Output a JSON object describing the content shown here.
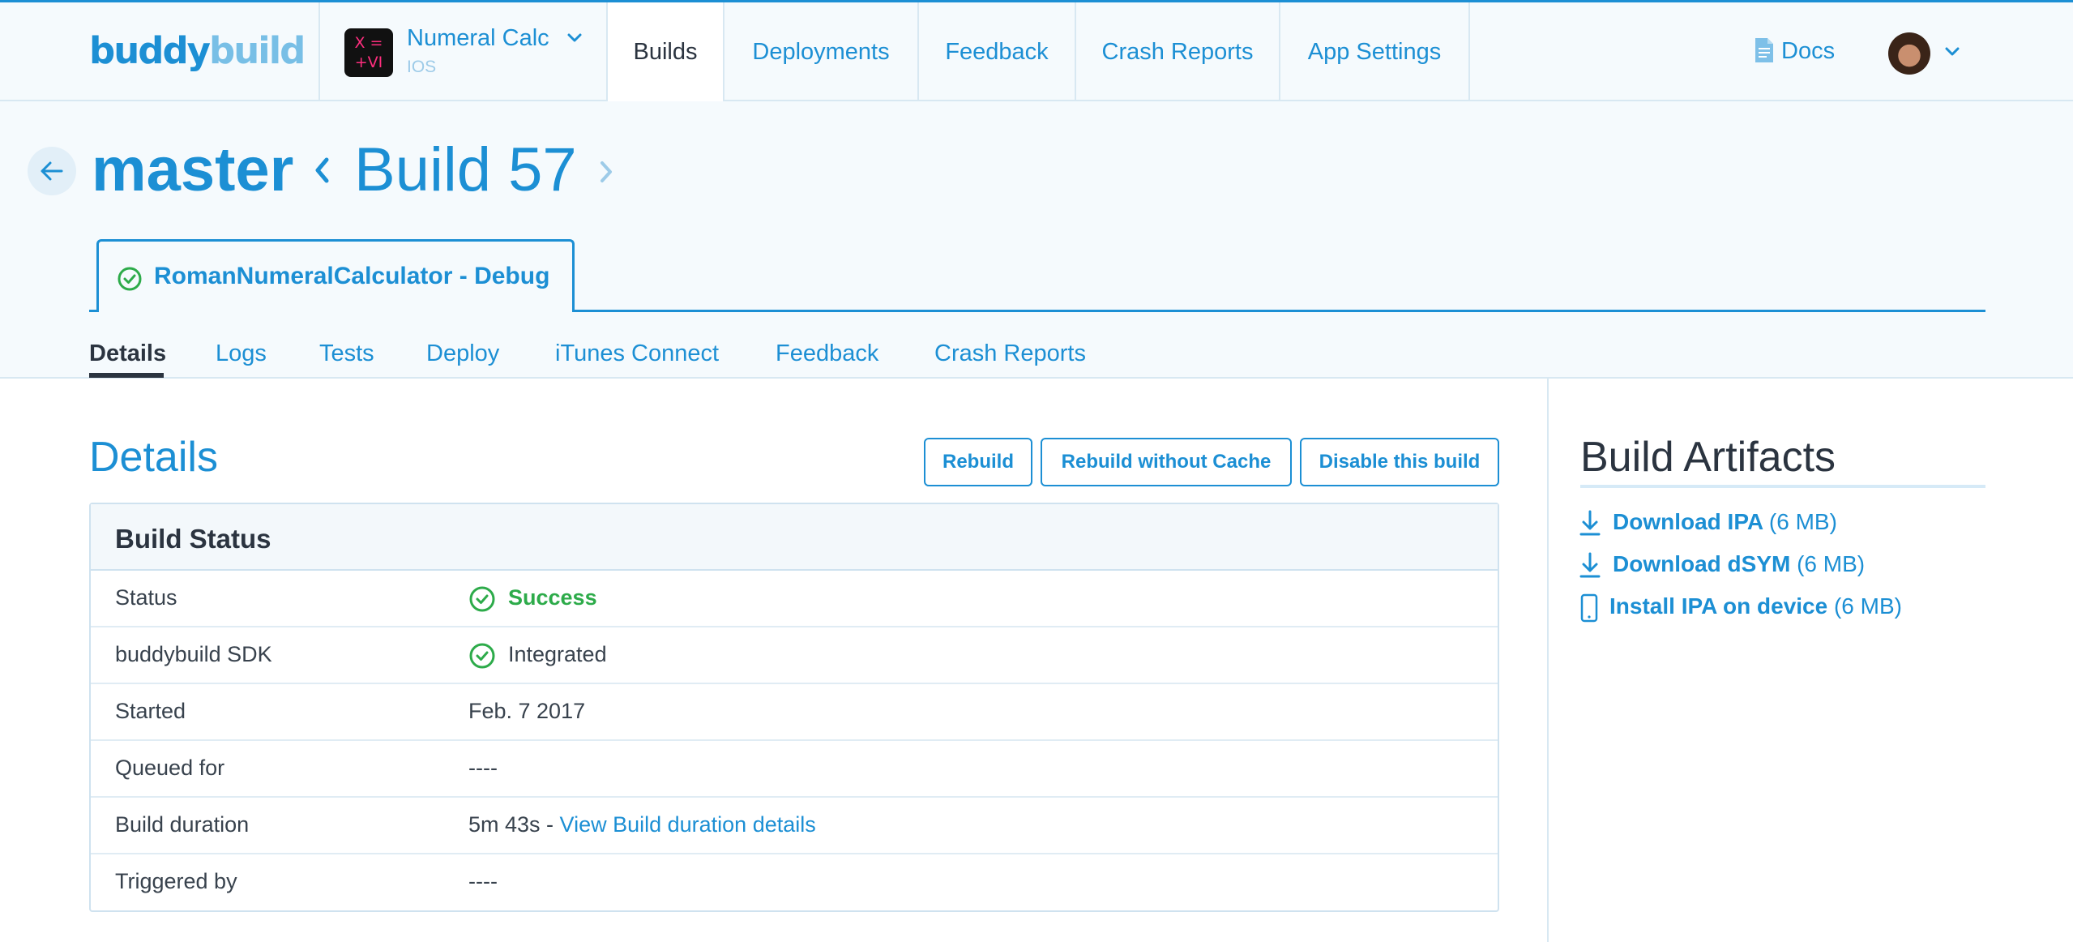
{
  "topnav": {
    "logo_part1": "buddy",
    "logo_part2": "build",
    "app": {
      "icon_line1": "X =",
      "icon_line2": "+VI",
      "name": "Numeral Calc",
      "platform": "IOS"
    },
    "tabs": [
      {
        "label": "Builds",
        "active": true
      },
      {
        "label": "Deployments"
      },
      {
        "label": "Feedback"
      },
      {
        "label": "Crash Reports"
      },
      {
        "label": "App Settings"
      }
    ],
    "docs_label": "Docs"
  },
  "header": {
    "branch": "master",
    "build": "Build 57",
    "scheme": "RomanNumeralCalculator - Debug",
    "subtabs": [
      {
        "label": "Details",
        "active": true
      },
      {
        "label": "Logs"
      },
      {
        "label": "Tests"
      },
      {
        "label": "Deploy"
      },
      {
        "label": "iTunes Connect"
      },
      {
        "label": "Feedback"
      },
      {
        "label": "Crash Reports"
      }
    ]
  },
  "details": {
    "title": "Details",
    "buttons": {
      "rebuild": "Rebuild",
      "rebuild_no_cache": "Rebuild without Cache",
      "disable": "Disable this build"
    },
    "table_title": "Build Status",
    "rows": [
      {
        "label": "Status",
        "value": "Success"
      },
      {
        "label": "buddybuild SDK",
        "value": "Integrated"
      },
      {
        "label": "Started",
        "value": "Feb. 7 2017"
      },
      {
        "label": "Queued for",
        "value": "----"
      },
      {
        "label": "Build duration",
        "value": "5m 43s - ",
        "link": "View Build duration details"
      },
      {
        "label": "Triggered by",
        "value": "----"
      }
    ]
  },
  "artifacts": {
    "title": "Build Artifacts",
    "items": [
      {
        "label": "Download IPA",
        "size": "(6 MB)"
      },
      {
        "label": "Download dSYM",
        "size": "(6 MB)"
      },
      {
        "label": "Install IPA on device",
        "size": "(6 MB)"
      }
    ]
  },
  "colors": {
    "brand_blue": "#1c8fd4",
    "light_blue": "#78bfe6",
    "success_green": "#2dab4a",
    "header_bg": "#f5fafd"
  },
  "icons": [
    "back-arrow-icon",
    "chevron-down-icon",
    "chevron-left-icon",
    "chevron-right-icon",
    "document-icon",
    "check-circle-icon",
    "download-icon",
    "phone-icon"
  ]
}
